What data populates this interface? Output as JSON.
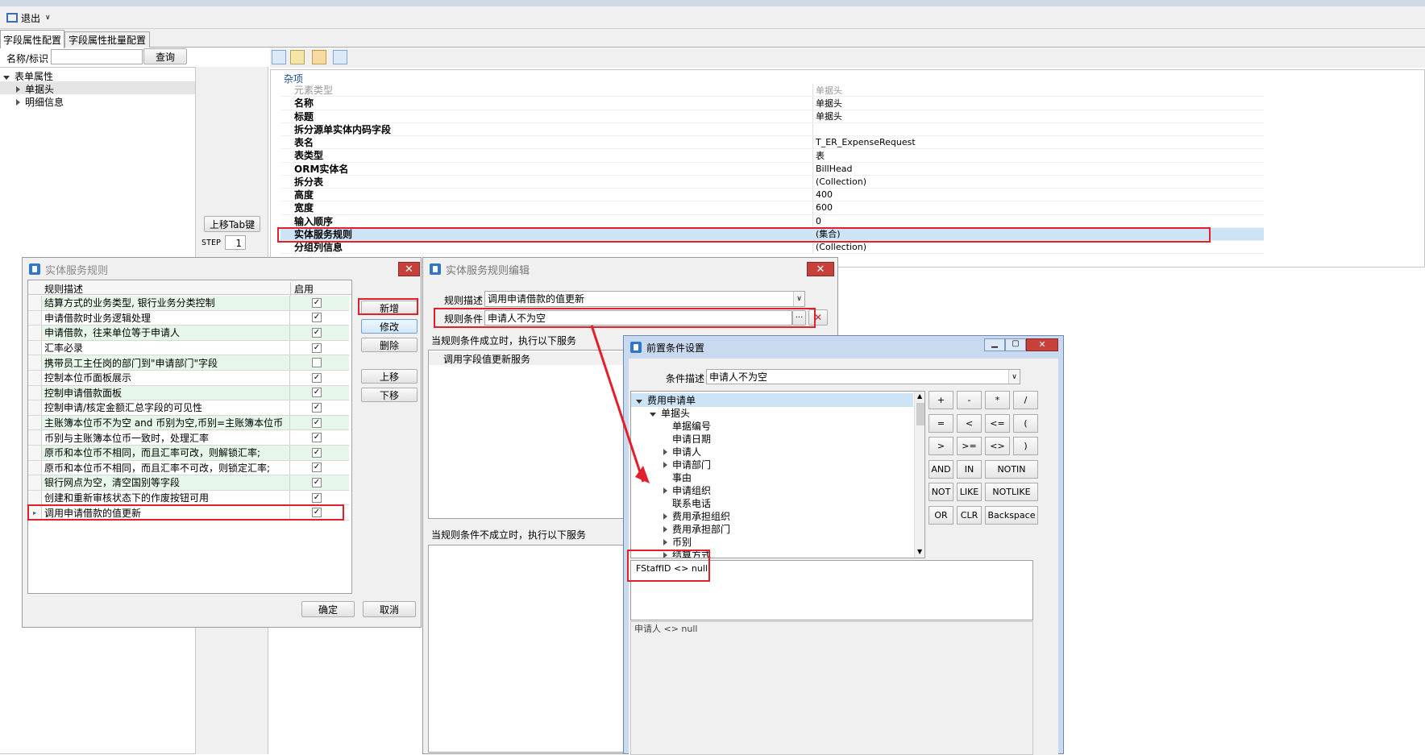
{
  "toolbar": {
    "exit_label": "退出"
  },
  "tabs": [
    {
      "label": "字段属性配置"
    },
    {
      "label": "字段属性批量配置"
    }
  ],
  "search": {
    "label": "名称/标识",
    "value": "",
    "button": "查询"
  },
  "tree": {
    "root": "表单属性",
    "children": [
      "单据头",
      "明细信息"
    ]
  },
  "left_controls": {
    "move_tab_button": "上移Tab键",
    "step_label": "STEP",
    "step_value": "1"
  },
  "props": {
    "section": "杂项",
    "rows": [
      {
        "name": "元素类型",
        "value": "单据头"
      },
      {
        "name": "名称",
        "value": "单据头"
      },
      {
        "name": "标题",
        "value": "单据头"
      },
      {
        "name": "拆分源单实体内码字段",
        "value": ""
      },
      {
        "name": "表名",
        "value": "T_ER_ExpenseRequest"
      },
      {
        "name": "表类型",
        "value": "表"
      },
      {
        "name": "ORM实体名",
        "value": "BillHead"
      },
      {
        "name": "拆分表",
        "value": "(Collection)"
      },
      {
        "name": "高度",
        "value": "400"
      },
      {
        "name": "宽度",
        "value": "600"
      },
      {
        "name": "输入顺序",
        "value": "0"
      },
      {
        "name": "实体服务规则",
        "value": "(集合)"
      },
      {
        "name": "分组列信息",
        "value": "(Collection)"
      }
    ]
  },
  "rules_dialog": {
    "title": "实体服务规则",
    "col_desc": "规则描述",
    "col_enabled": "启用",
    "rows": [
      {
        "desc": "结算方式的业务类型, 银行业务分类控制",
        "checked": true
      },
      {
        "desc": "申请借款时业务逻辑处理",
        "checked": true
      },
      {
        "desc": "申请借款，往来单位等于申请人",
        "checked": true
      },
      {
        "desc": "汇率必录",
        "checked": true
      },
      {
        "desc": "携带员工主任岗的部门到\"申请部门\"字段",
        "checked": false
      },
      {
        "desc": "控制本位币面板展示",
        "checked": true
      },
      {
        "desc": "控制申请借款面板",
        "checked": true
      },
      {
        "desc": "控制申请/核定金额汇总字段的可见性",
        "checked": true
      },
      {
        "desc": "主账簿本位币不为空 and 币别为空,币别=主账簿本位币",
        "checked": true
      },
      {
        "desc": "币别与主账簿本位币一致时，处理汇率",
        "checked": true
      },
      {
        "desc": "原币和本位币不相同，而且汇率可改，则解锁汇率;",
        "checked": true
      },
      {
        "desc": "原币和本位币不相同，而且汇率不可改，则锁定汇率;",
        "checked": true
      },
      {
        "desc": "银行网点为空，清空国别等字段",
        "checked": true
      },
      {
        "desc": "创建和重新审核状态下的作废按钮可用",
        "checked": true
      },
      {
        "desc": "调用申请借款的值更新",
        "checked": true
      }
    ],
    "buttons": {
      "add": "新增",
      "edit": "修改",
      "delete": "删除",
      "up": "上移",
      "down": "下移",
      "ok": "确定",
      "cancel": "取消"
    }
  },
  "edit_dialog": {
    "title": "实体服务规则编辑",
    "desc_label": "规则描述",
    "desc_value": "调用申请借款的值更新",
    "cond_label": "规则条件",
    "cond_value": "申请人不为空",
    "true_label": "当规则条件成立时，执行以下服务",
    "true_items": [
      "调用字段值更新服务"
    ],
    "false_label": "当规则条件不成立时，执行以下服务",
    "ellipsis": "···"
  },
  "pre_dialog": {
    "title": "前置条件设置",
    "cond_label": "条件描述",
    "cond_value": "申请人不为空",
    "tree": [
      {
        "label": "费用申请单",
        "level": 0,
        "arrow": "down"
      },
      {
        "label": "单据头",
        "level": 1,
        "arrow": "down"
      },
      {
        "label": "单据编号",
        "level": 2,
        "arrow": ""
      },
      {
        "label": "申请日期",
        "level": 2,
        "arrow": ""
      },
      {
        "label": "申请人",
        "level": 2,
        "arrow": "right"
      },
      {
        "label": "申请部门",
        "level": 2,
        "arrow": "right"
      },
      {
        "label": "事由",
        "level": 2,
        "arrow": ""
      },
      {
        "label": "申请组织",
        "level": 2,
        "arrow": "right"
      },
      {
        "label": "联系电话",
        "level": 2,
        "arrow": ""
      },
      {
        "label": "费用承担组织",
        "level": 2,
        "arrow": "right"
      },
      {
        "label": "费用承担部门",
        "level": 2,
        "arrow": "right"
      },
      {
        "label": "币别",
        "level": 2,
        "arrow": "right"
      },
      {
        "label": "结算方式",
        "level": 2,
        "arrow": "right"
      }
    ],
    "buttons": [
      [
        "+",
        "-",
        "*",
        "/"
      ],
      [
        "=",
        "<",
        "<=",
        "("
      ],
      [
        ">",
        ">=",
        "<>",
        ")"
      ],
      [
        "AND",
        "IN",
        "NOTIN"
      ],
      [
        "NOT",
        "LIKE",
        "NOTLIKE"
      ],
      [
        "OR",
        "CLR",
        "Backspace"
      ]
    ],
    "expression": "FStaffID  <> null",
    "display": "申请人  <> null"
  }
}
